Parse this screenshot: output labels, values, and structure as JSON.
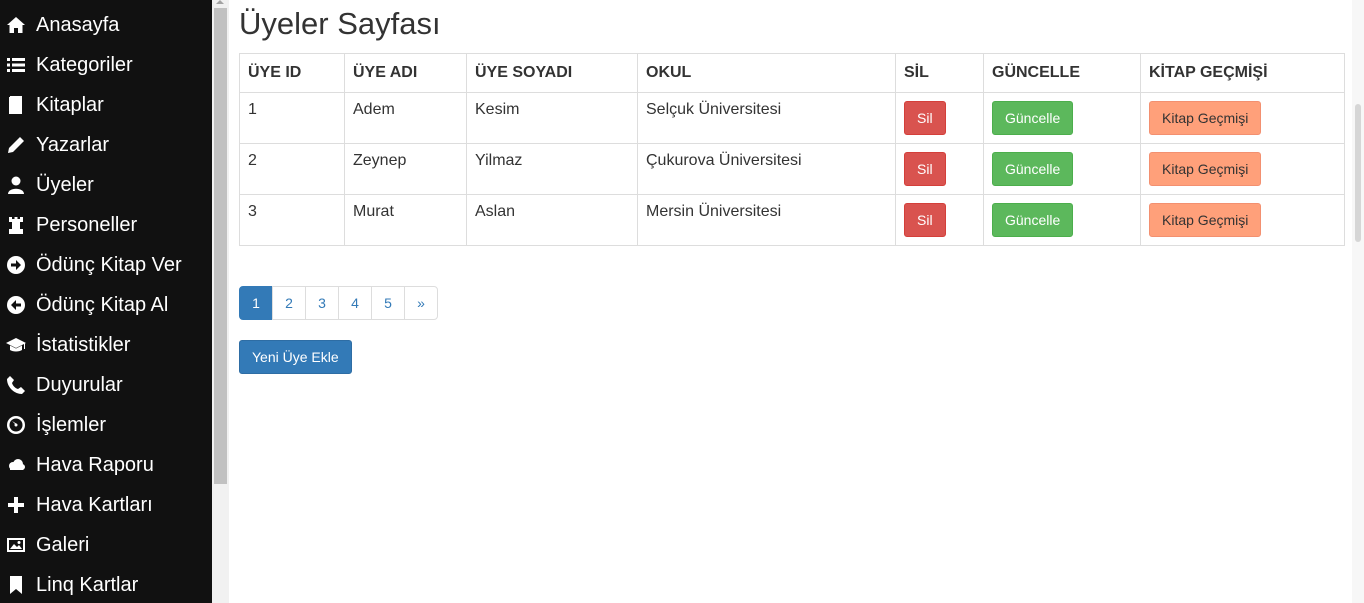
{
  "sidebar": {
    "items": [
      {
        "label": "Anasayfa",
        "icon": "home-icon"
      },
      {
        "label": "Kategoriler",
        "icon": "list-icon"
      },
      {
        "label": "Kitaplar",
        "icon": "book-icon"
      },
      {
        "label": "Yazarlar",
        "icon": "pencil-icon"
      },
      {
        "label": "Üyeler",
        "icon": "user-icon"
      },
      {
        "label": "Personeller",
        "icon": "tower-icon"
      },
      {
        "label": "Ödünç Kitap Ver",
        "icon": "arrow-right-circle-icon"
      },
      {
        "label": "Ödünç Kitap Al",
        "icon": "arrow-left-circle-icon"
      },
      {
        "label": "İstatistikler",
        "icon": "graduation-cap-icon"
      },
      {
        "label": "Duyurular",
        "icon": "phone-icon"
      },
      {
        "label": "İşlemler",
        "icon": "dashboard-icon"
      },
      {
        "label": "Hava Raporu",
        "icon": "cloud-icon"
      },
      {
        "label": "Hava Kartları",
        "icon": "plus-icon"
      },
      {
        "label": "Galeri",
        "icon": "picture-icon"
      },
      {
        "label": "Linq Kartlar",
        "icon": "bookmark-icon"
      }
    ]
  },
  "page": {
    "title": "Üyeler Sayfası"
  },
  "table": {
    "headers": {
      "id": "ÜYE ID",
      "name": "ÜYE ADI",
      "surname": "ÜYE SOYADI",
      "school": "OKUL",
      "delete": "SİL",
      "update": "GÜNCELLE",
      "history": "KİTAP GEÇMİŞİ"
    },
    "rows": [
      {
        "id": "1",
        "name": "Adem",
        "surname": "Kesim",
        "school": "Selçuk Üniversitesi",
        "delete": "Sil",
        "update": "Güncelle",
        "history": "Kitap Geçmişi"
      },
      {
        "id": "2",
        "name": "Zeynep",
        "surname": "Yilmaz",
        "school": "Çukurova Üniversitesi",
        "delete": "Sil",
        "update": "Güncelle",
        "history": "Kitap Geçmişi"
      },
      {
        "id": "3",
        "name": "Murat",
        "surname": "Aslan",
        "school": "Mersin Üniversitesi",
        "delete": "Sil",
        "update": "Güncelle",
        "history": "Kitap Geçmişi"
      }
    ]
  },
  "pagination": {
    "pages": [
      "1",
      "2",
      "3",
      "4",
      "5"
    ],
    "next": "»",
    "current": "1"
  },
  "actions": {
    "add_label": "Yeni Üye Ekle"
  },
  "colors": {
    "sidebar_bg": "#111111",
    "danger": "#d9534f",
    "success": "#5cb85c",
    "warning": "#ffa07a",
    "primary": "#337ab7"
  }
}
